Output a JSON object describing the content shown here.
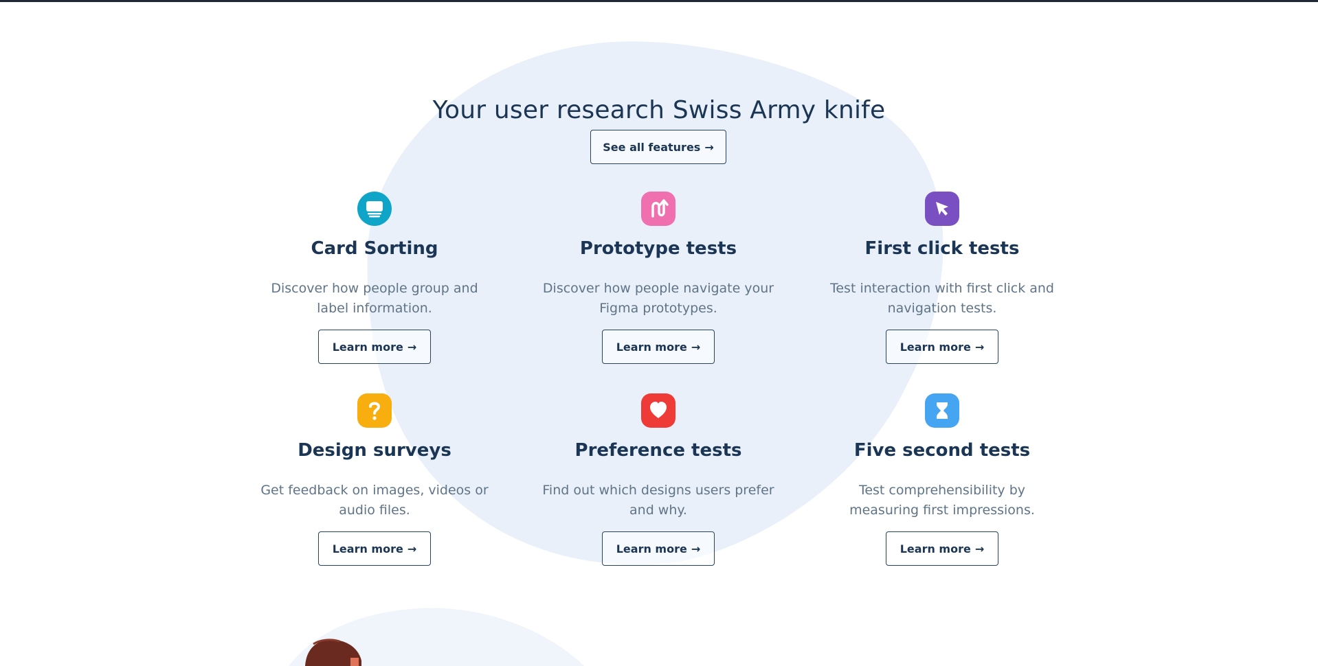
{
  "header": {
    "title": "Your user research Swiss Army knife",
    "see_all_label": "See all features"
  },
  "arrow": "→",
  "features": [
    {
      "title": "Card Sorting",
      "description": "Discover how people group and label information.",
      "button": "Learn more",
      "icon": "card-sorting-icon",
      "color": "#0ea5c8"
    },
    {
      "title": "Prototype tests",
      "description": "Discover how people navigate your Figma prototypes.",
      "button": "Learn more",
      "icon": "prototype-path-icon",
      "color": "#f06fae"
    },
    {
      "title": "First click tests",
      "description": "Test interaction with first click and navigation tests.",
      "button": "Learn more",
      "icon": "cursor-click-icon",
      "color": "#7a4fc2"
    },
    {
      "title": "Design surveys",
      "description": "Get feedback on images, videos or audio files.",
      "button": "Learn more",
      "icon": "question-mark-icon",
      "color": "#f8ae0e"
    },
    {
      "title": "Preference tests",
      "description": "Find out which designs users prefer and why.",
      "button": "Learn more",
      "icon": "heart-icon",
      "color": "#ee3b38"
    },
    {
      "title": "Five second tests",
      "description": "Test comprehensibility by measuring first impressions.",
      "button": "Learn more",
      "icon": "hourglass-icon",
      "color": "#45a5f2"
    }
  ],
  "colors": {
    "blob_primary": "#e9f0f9",
    "blob_secondary": "#f0f4fb",
    "text_dark": "#1b3554",
    "text_muted": "#5f7487"
  }
}
